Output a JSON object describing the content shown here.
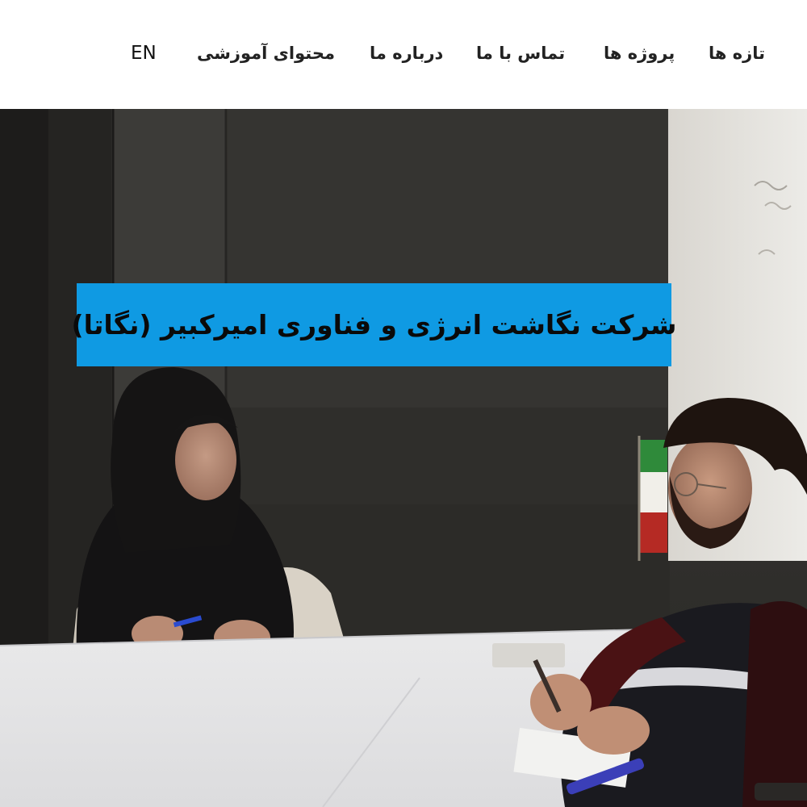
{
  "nav": {
    "items": [
      {
        "label": "تازه ها"
      },
      {
        "label": "پروژه ها"
      },
      {
        "label": "تماس با ما"
      },
      {
        "label": "درباره ما"
      },
      {
        "label": "محتوای آموزشی"
      }
    ],
    "language_switch": "EN"
  },
  "hero": {
    "banner_title": "شرکت نگاشت انرژی و فناوری امیرکبیر (نگاتا)",
    "banner_color": "#0f9ae3"
  }
}
